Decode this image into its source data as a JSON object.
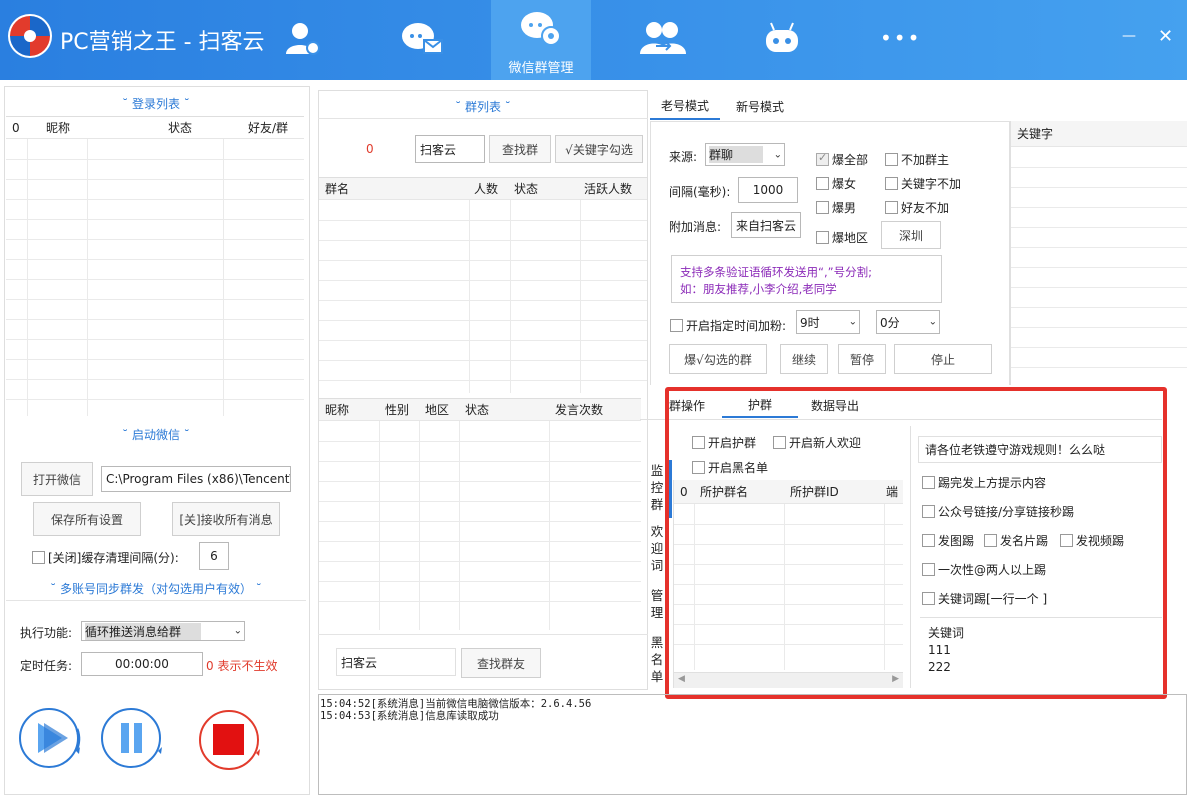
{
  "app": {
    "title": "PC营销之王 - 扫客云",
    "nav_active_label": "微信群管理",
    "more_glyph": "•••",
    "minimize_glyph": "—",
    "close_glyph": "✕"
  },
  "left": {
    "login_title": "˘ 登录列表 ˘",
    "login_headers": [
      "0",
      "昵称",
      "状态",
      "好友/群"
    ],
    "start_title": "˘ 启动微信 ˘",
    "open_wechat": "打开微信",
    "wechat_path": "C:\\Program Files (x86)\\Tencent\\",
    "save_settings": "保存所有设置",
    "receive_msgs": "[关]接收所有消息",
    "cache_label": "[关闭]缓存清理间隔(分):",
    "cache_value": "6",
    "multi_title": "˘ 多账号同步群发（对勾选用户有效） ˘",
    "exec_label": "执行功能:",
    "exec_value": "循环推送消息给群",
    "timer_label": "定时任务:",
    "timer_value": "00:00:00",
    "timer_hint": "0 表示不生效"
  },
  "middle": {
    "group_title": "˘ 群列表 ˘",
    "group_count": "0",
    "search_value": "扫客云",
    "find_group": "查找群",
    "keyword_check": "√关键字勾选",
    "group_headers": [
      "群名",
      "人数",
      "状态",
      "活跃人数"
    ],
    "member_headers": [
      "昵称",
      "性别",
      "地区",
      "状态",
      "发言次数"
    ],
    "friend_search_value": "扫客云",
    "find_friend": "查找群友"
  },
  "right": {
    "tabs": [
      "老号模式",
      "新号模式"
    ],
    "source_label": "来源:",
    "source_value": "群聊",
    "interval_label": "间隔(毫秒):",
    "interval_value": "1000",
    "extra_label": "附加消息:",
    "extra_value": "来自扫客云",
    "checks": {
      "all": "爆全部",
      "female": "爆女",
      "male": "爆男",
      "region": "爆地区",
      "no_owner": "不加群主",
      "no_keyword": "关键字不加",
      "no_friend": "好友不加"
    },
    "region_value": "深圳",
    "hint_line1": "支持多条验证语循环发送用“,”号分割;",
    "hint_line2": "如：朋友推荐,小李介绍,老同学",
    "timed_label": "开启指定时间加粉:",
    "hour_value": "9时",
    "minute_value": "0分",
    "btn_blast": "爆√勾选的群",
    "btn_continue": "继续",
    "btn_pause": "暂停",
    "btn_stop": "停止",
    "keyword_header": "关键字"
  },
  "bottom": {
    "tabs": [
      "群操作",
      "护群",
      "数据导出"
    ],
    "protect": "开启护群",
    "welcome": "开启新人欢迎",
    "blacklist": "开启黑名单",
    "side_tabs": [
      "监控群",
      "欢迎词",
      "管理",
      "黑名单"
    ],
    "table_headers": [
      "0",
      "所护群名",
      "所护群ID",
      "端"
    ],
    "notice_value": "请各位老铁遵守游戏规则！么么哒",
    "opts": {
      "kick_after": "踢完发上方提示内容",
      "kick_link": "公众号链接/分享链接秒踢",
      "kick_img": "发图踢",
      "kick_card": "发名片踢",
      "kick_video": "发视频踢",
      "kick_at": "一次性@两人以上踢",
      "kick_keyword": "关键词踢[一行一个 ]"
    },
    "keywords_title": "关键词",
    "keywords": [
      "111",
      "222"
    ]
  },
  "log": [
    "15:04:52[系统消息]当前微信电脑微信版本：2.6.4.56",
    "15:04:53[系统消息]信息库读取成功"
  ],
  "colors": {
    "header_bg": "#2f86e0",
    "active_tab": "#4da3ef",
    "accent": "#2c7ad6",
    "red_frame": "#e5312b",
    "hint_text": "#8b2ab8"
  },
  "icons": [
    "logo-icon",
    "user-settings-icon",
    "chat-mail-icon",
    "wechat-group-icon",
    "contacts-transfer-icon",
    "robot-icon"
  ]
}
